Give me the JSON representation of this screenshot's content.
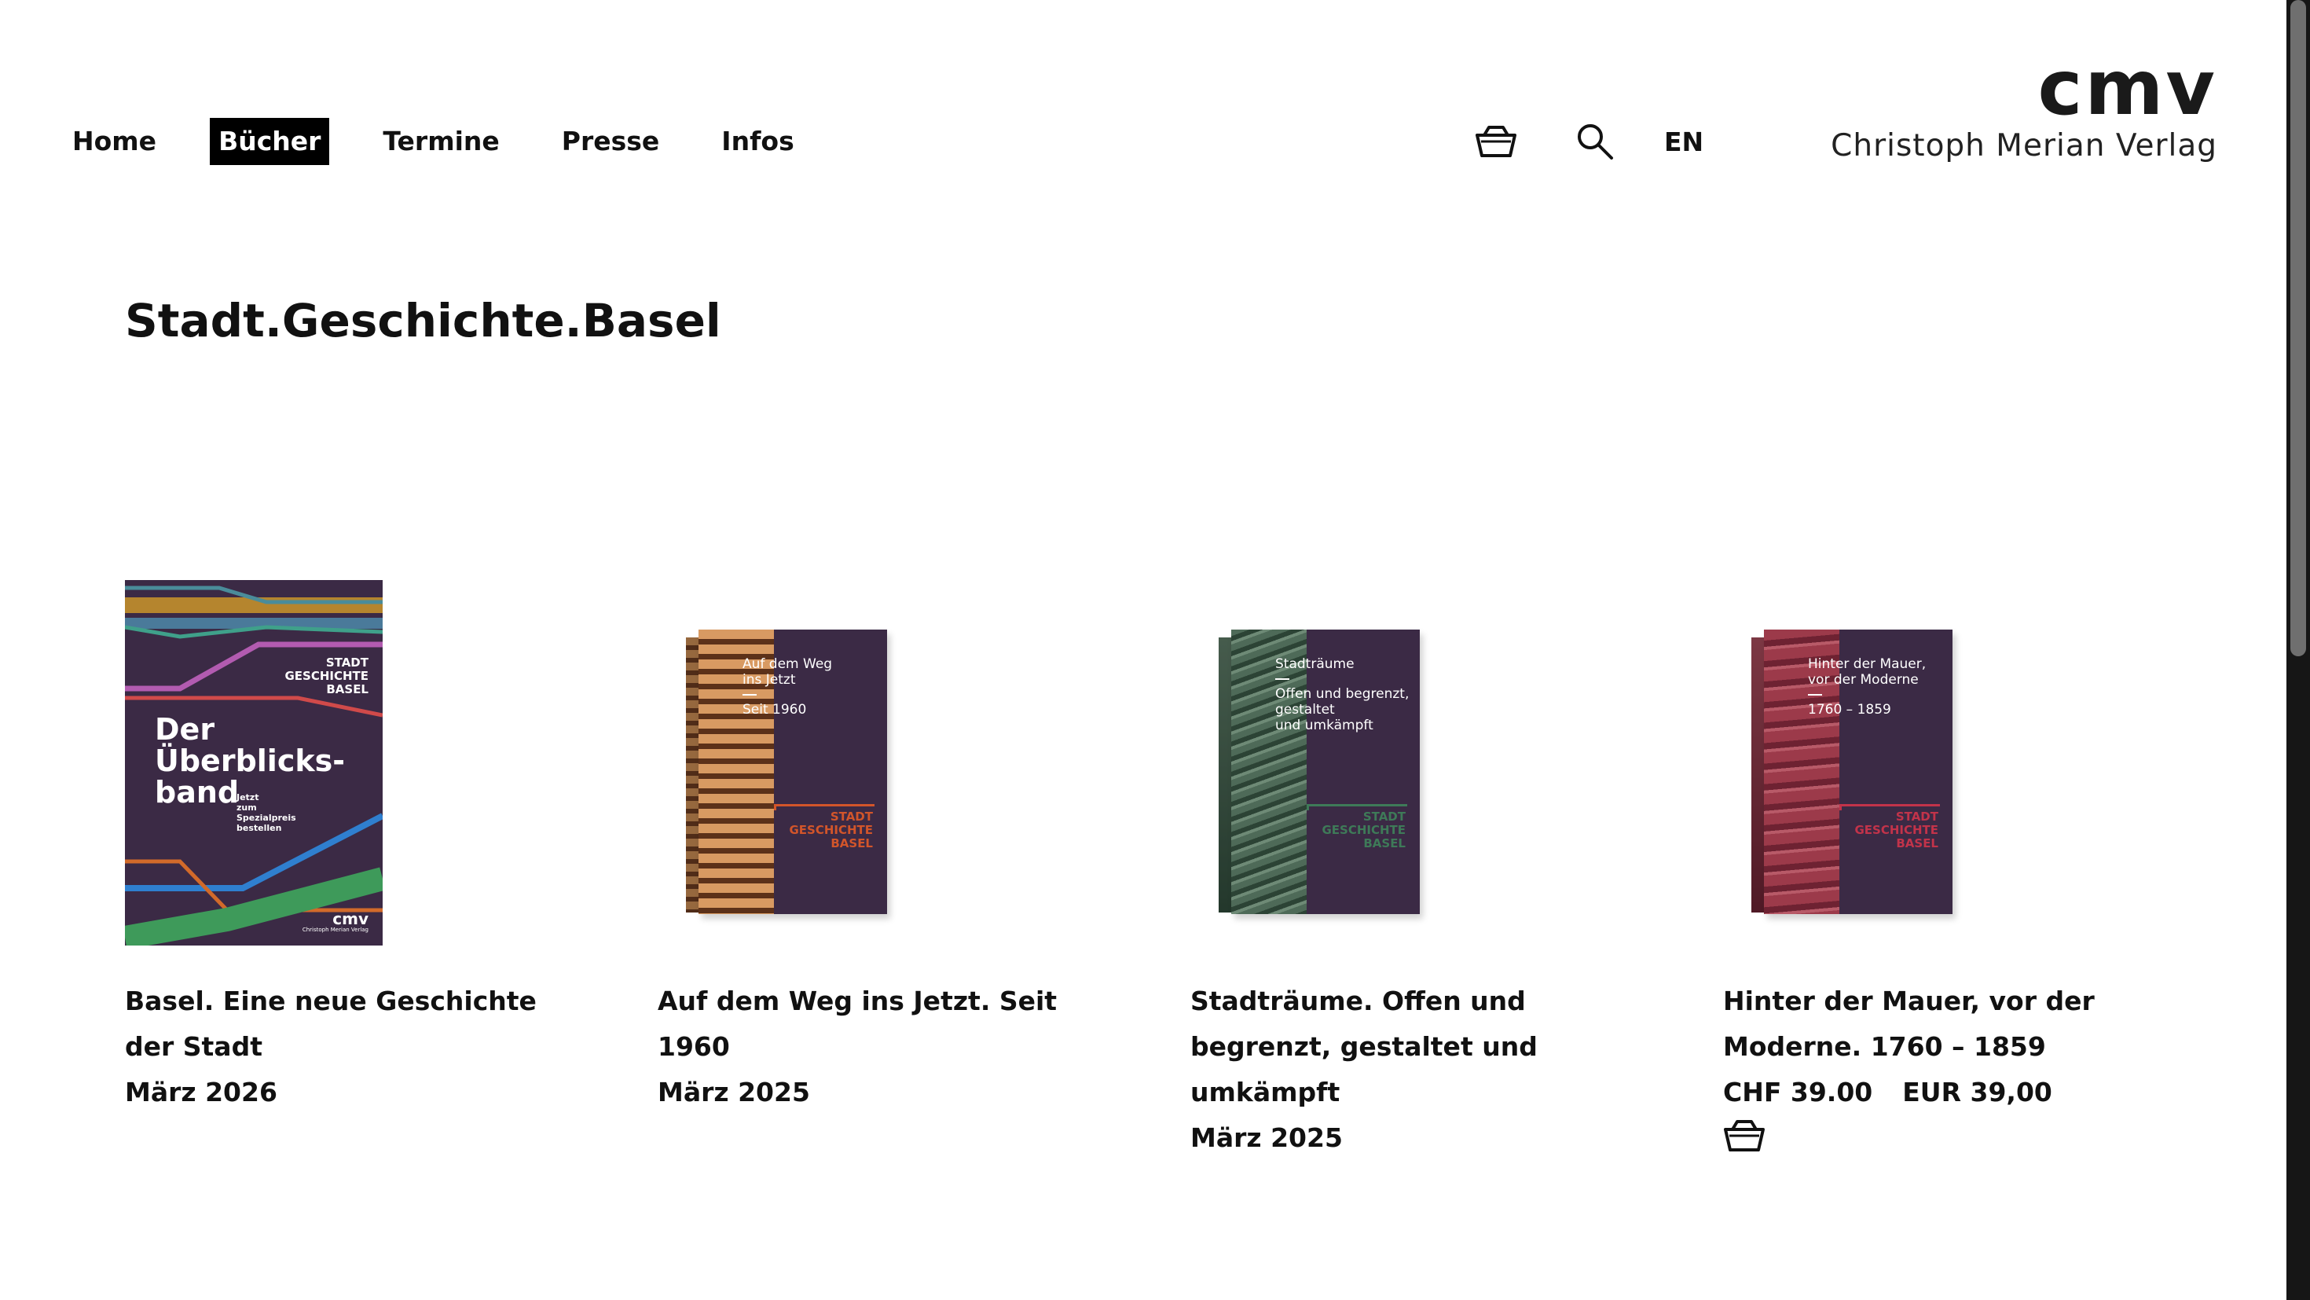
{
  "nav": {
    "items": [
      {
        "label": "Home"
      },
      {
        "label": "Bücher"
      },
      {
        "label": "Termine"
      },
      {
        "label": "Presse"
      },
      {
        "label": "Infos"
      }
    ]
  },
  "header": {
    "lang": "EN",
    "logo_mark": "cmv",
    "logo_text": "Christoph Merian Verlag"
  },
  "page": {
    "title": "Stadt.Geschichte.Basel"
  },
  "books": [
    {
      "title": "Basel. Eine neue Geschichte der Stadt",
      "date": "März 2026",
      "cover": {
        "series": "STADT\nGESCHICHTE\nBASEL",
        "headline": "Der\nÜberblicks-\nband",
        "note": "Jetzt\nzum\nSpezialpreis\nbestellen",
        "logo_mark": "cmv",
        "logo_text": "Christoph Merian Verlag"
      }
    },
    {
      "title": "Auf dem Weg ins Jetzt. Seit 1960",
      "date": "März 2025",
      "cover": {
        "title": "Auf dem Weg\nins Jetzt",
        "sub": "Seit 1960",
        "brand": "STADT\nGESCHICHTE\nBASEL"
      }
    },
    {
      "title": "Stadträume. Offen und begrenzt, gestaltet und umkämpft",
      "date": "März 2025",
      "cover": {
        "title": "Stadträume",
        "sub": "Offen und begrenzt,\ngestaltet\nund umkämpft",
        "brand": "STADT\nGESCHICHTE\nBASEL"
      }
    },
    {
      "title": "Hinter der Mauer, vor der Moderne. 1760 – 1859",
      "price_chf": "CHF 39.00",
      "price_eur": "EUR 39,00",
      "cover": {
        "title": "Hinter der Mauer,\nvor der Moderne",
        "sub": "1760 – 1859",
        "brand": "STADT\nGESCHICHTE\nBASEL"
      }
    }
  ],
  "colors": {
    "cover_purple": "#3b2a45",
    "accent_orange": "#d2552a",
    "accent_green": "#3e7a58",
    "accent_red": "#c2334a"
  }
}
